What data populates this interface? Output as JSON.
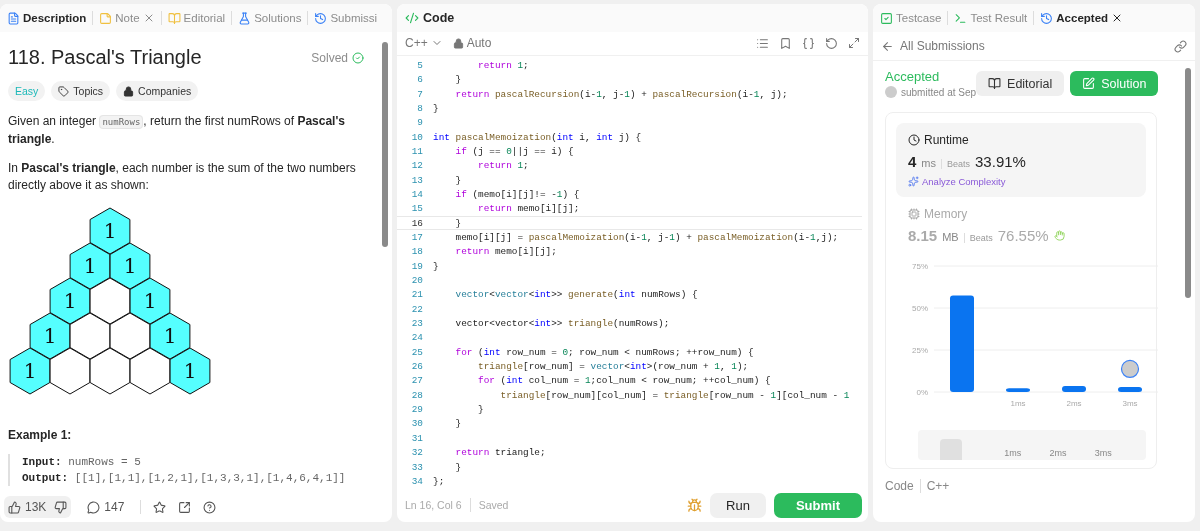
{
  "left_panel": {
    "tabs": [
      {
        "label": "Description",
        "kind": "description",
        "selected": true,
        "closable": false
      },
      {
        "label": "Note",
        "kind": "note",
        "selected": false,
        "closable": true
      },
      {
        "label": "Editorial",
        "kind": "editorial",
        "selected": false,
        "closable": false
      },
      {
        "label": "Solutions",
        "kind": "solutions",
        "selected": false,
        "closable": false
      },
      {
        "label": "Submissi",
        "kind": "submissions",
        "selected": false,
        "closable": false
      }
    ],
    "title": "118. Pascal's Triangle",
    "status": "Solved",
    "badges": [
      {
        "kind": "difficulty",
        "label": "Easy"
      },
      {
        "kind": "topics",
        "label": "Topics"
      },
      {
        "kind": "companies",
        "label": "Companies"
      }
    ],
    "paragraph_1": {
      "before": "Given an integer ",
      "code": "numRows",
      "after": ", return the first numRows of **Pascal's triangle**."
    },
    "paragraph_2": "In **Pascal's triangle**, each number is the sum of the two numbers directly above it as shown:",
    "triangle_rows": [
      [
        {
          "value": "1",
          "filled": true
        }
      ],
      [
        {
          "value": "1",
          "filled": true
        },
        {
          "value": "1",
          "filled": true
        }
      ],
      [
        {
          "value": "1",
          "filled": true
        },
        {
          "filled": false
        },
        {
          "value": "1",
          "filled": true
        }
      ],
      [
        {
          "value": "1",
          "filled": true
        },
        {
          "filled": false
        },
        {
          "filled": false
        },
        {
          "value": "1",
          "filled": true
        }
      ],
      [
        {
          "value": "1",
          "filled": true
        },
        {
          "filled": false
        },
        {
          "filled": false
        },
        {
          "filled": false
        },
        {
          "value": "1",
          "filled": true
        }
      ]
    ],
    "example_title": "Example 1:",
    "example_lines": [
      {
        "label": "Input:",
        "value": "numRows = 5"
      },
      {
        "label": "Output:",
        "value": "[[1],[1,1],[1,2,1],[1,3,3,1],[1,4,6,4,1]]"
      }
    ],
    "footer": {
      "likes": "13K",
      "comments": "147"
    }
  },
  "code_panel": {
    "title": "Code",
    "language": "C++",
    "mode": "Auto",
    "lines": [
      {
        "n": "5",
        "current": false,
        "parts": [
          {
            "kind": "kw",
            "text": "        return"
          },
          {
            "kind": "nu",
            "text": " 1"
          },
          {
            "kind": "p",
            "text": ";"
          }
        ]
      },
      {
        "n": "6",
        "current": false,
        "parts": [
          {
            "kind": "p",
            "text": "    }"
          }
        ]
      },
      {
        "n": "7",
        "current": false,
        "parts": [
          {
            "kind": "kw",
            "text": "    return"
          },
          {
            "kind": "fn",
            "text": " pascalRecursion"
          },
          {
            "kind": "p",
            "text": "(i-"
          },
          {
            "kind": "nu",
            "text": "1"
          },
          {
            "kind": "p",
            "text": ", j-"
          },
          {
            "kind": "nu",
            "text": "1"
          },
          {
            "kind": "p",
            "text": ") + "
          },
          {
            "kind": "fn",
            "text": "pascalRecursion"
          },
          {
            "kind": "p",
            "text": "(i-"
          },
          {
            "kind": "nu",
            "text": "1"
          },
          {
            "kind": "p",
            "text": ", j);"
          }
        ]
      },
      {
        "n": "8",
        "current": false,
        "parts": [
          {
            "kind": "p",
            "text": "}"
          }
        ]
      },
      {
        "n": "9",
        "current": false
      },
      {
        "n": "10",
        "current": false,
        "parts": [
          {
            "kind": "ty",
            "text": "int"
          },
          {
            "kind": "fn",
            "text": " pascalMemoization"
          },
          {
            "kind": "p",
            "text": "("
          },
          {
            "kind": "ty",
            "text": "int"
          },
          {
            "kind": "p",
            "text": " i, "
          },
          {
            "kind": "ty",
            "text": "int"
          },
          {
            "kind": "p",
            "text": " j) {"
          }
        ]
      },
      {
        "n": "11",
        "current": false,
        "parts": [
          {
            "kind": "kw",
            "text": "    if"
          },
          {
            "kind": "p",
            "text": " (j == "
          },
          {
            "kind": "nu",
            "text": "0"
          },
          {
            "kind": "p",
            "text": "||j == i) {"
          }
        ]
      },
      {
        "n": "12",
        "current": false,
        "parts": [
          {
            "kind": "kw",
            "text": "        return"
          },
          {
            "kind": "nu",
            "text": " 1"
          },
          {
            "kind": "p",
            "text": ";"
          }
        ]
      },
      {
        "n": "13",
        "current": false,
        "parts": [
          {
            "kind": "p",
            "text": "    }"
          }
        ]
      },
      {
        "n": "14",
        "current": false,
        "parts": [
          {
            "kind": "kw",
            "text": "    if"
          },
          {
            "kind": "p",
            "text": " (memo[i][j]!= -"
          },
          {
            "kind": "nu",
            "text": "1"
          },
          {
            "kind": "p",
            "text": ") {"
          }
        ]
      },
      {
        "n": "15",
        "current": false,
        "parts": [
          {
            "kind": "kw",
            "text": "        return"
          },
          {
            "kind": "p",
            "text": " memo[i][j];"
          }
        ]
      },
      {
        "n": "16",
        "current": true,
        "parts": [
          {
            "kind": "p",
            "text": "    }"
          }
        ]
      },
      {
        "n": "17",
        "current": false,
        "parts": [
          {
            "kind": "p",
            "text": "    memo[i][j] = "
          },
          {
            "kind": "fn",
            "text": "pascalMemoization"
          },
          {
            "kind": "p",
            "text": "(i-"
          },
          {
            "kind": "nu",
            "text": "1"
          },
          {
            "kind": "p",
            "text": ", j-"
          },
          {
            "kind": "nu",
            "text": "1"
          },
          {
            "kind": "p",
            "text": ") + "
          },
          {
            "kind": "fn",
            "text": "pascalMemoization"
          },
          {
            "kind": "p",
            "text": "(i-"
          },
          {
            "kind": "nu",
            "text": "1"
          },
          {
            "kind": "p",
            "text": ",j);"
          }
        ]
      },
      {
        "n": "18",
        "current": false,
        "parts": [
          {
            "kind": "kw",
            "text": "    return"
          },
          {
            "kind": "p",
            "text": " memo[i][j];"
          }
        ]
      },
      {
        "n": "19",
        "current": false,
        "parts": [
          {
            "kind": "p",
            "text": "}"
          }
        ]
      },
      {
        "n": "20",
        "current": false
      },
      {
        "n": "21",
        "current": false,
        "parts": [
          {
            "kind": "cl",
            "text": "    vector"
          },
          {
            "kind": "p",
            "text": "<"
          },
          {
            "kind": "cl",
            "text": "vector"
          },
          {
            "kind": "p",
            "text": "<"
          },
          {
            "kind": "ty",
            "text": "int"
          },
          {
            "kind": "p",
            "text": ">> "
          },
          {
            "kind": "fn",
            "text": "generate"
          },
          {
            "kind": "p",
            "text": "("
          },
          {
            "kind": "ty",
            "text": "int"
          },
          {
            "kind": "p",
            "text": " numRows) {"
          }
        ]
      },
      {
        "n": "22",
        "current": false
      },
      {
        "n": "23",
        "current": false,
        "parts": [
          {
            "kind": "p",
            "text": "    vector<vector<"
          },
          {
            "kind": "ty",
            "text": "int"
          },
          {
            "kind": "p",
            "text": ">> "
          },
          {
            "kind": "fn",
            "text": "triangle"
          },
          {
            "kind": "p",
            "text": "(numRows);"
          }
        ]
      },
      {
        "n": "24",
        "current": false
      },
      {
        "n": "25",
        "current": false,
        "parts": [
          {
            "kind": "kw",
            "text": "    for"
          },
          {
            "kind": "p",
            "text": " ("
          },
          {
            "kind": "ty",
            "text": "int"
          },
          {
            "kind": "p",
            "text": " row_num = "
          },
          {
            "kind": "nu",
            "text": "0"
          },
          {
            "kind": "p",
            "text": "; row_num < numRows; ++row_num) {"
          }
        ]
      },
      {
        "n": "26",
        "current": false,
        "parts": [
          {
            "kind": "fn",
            "text": "        triangle"
          },
          {
            "kind": "p",
            "text": "[row_num] = "
          },
          {
            "kind": "cl",
            "text": "vector"
          },
          {
            "kind": "p",
            "text": "<"
          },
          {
            "kind": "ty",
            "text": "int"
          },
          {
            "kind": "p",
            "text": ">(row_num + "
          },
          {
            "kind": "nu",
            "text": "1"
          },
          {
            "kind": "p",
            "text": ", "
          },
          {
            "kind": "nu",
            "text": "1"
          },
          {
            "kind": "p",
            "text": ");"
          }
        ]
      },
      {
        "n": "27",
        "current": false,
        "parts": [
          {
            "kind": "kw",
            "text": "        for"
          },
          {
            "kind": "p",
            "text": " ("
          },
          {
            "kind": "ty",
            "text": "int"
          },
          {
            "kind": "p",
            "text": " col_num = "
          },
          {
            "kind": "nu",
            "text": "1"
          },
          {
            "kind": "p",
            "text": ";col_num < row_num; ++col_num) {"
          }
        ]
      },
      {
        "n": "28",
        "current": false,
        "parts": [
          {
            "kind": "fn",
            "text": "            triangle"
          },
          {
            "kind": "p",
            "text": "[row_num][col_num] = "
          },
          {
            "kind": "fn",
            "text": "triangle"
          },
          {
            "kind": "p",
            "text": "[row_num - "
          },
          {
            "kind": "nu",
            "text": "1"
          },
          {
            "kind": "p",
            "text": "][col_num - "
          },
          {
            "kind": "nu",
            "text": "1"
          }
        ]
      },
      {
        "n": "29",
        "current": false,
        "parts": [
          {
            "kind": "p",
            "text": "        }"
          }
        ]
      },
      {
        "n": "30",
        "current": false,
        "parts": [
          {
            "kind": "p",
            "text": "    }"
          }
        ]
      },
      {
        "n": "31",
        "current": false
      },
      {
        "n": "32",
        "current": false,
        "parts": [
          {
            "kind": "kw",
            "text": "    return"
          },
          {
            "kind": "p",
            "text": " triangle;"
          }
        ]
      },
      {
        "n": "33",
        "current": false,
        "parts": [
          {
            "kind": "p",
            "text": "    }"
          }
        ]
      },
      {
        "n": "34",
        "current": false,
        "parts": [
          {
            "kind": "p",
            "text": "};"
          }
        ]
      }
    ],
    "cursor": "Ln 16, Col 6",
    "save_status": "Saved",
    "buttons": [
      {
        "kind": "run",
        "label": "Run"
      },
      {
        "kind": "submit",
        "label": "Submit"
      }
    ]
  },
  "result_panel": {
    "tabs": [
      {
        "label": "Testcase",
        "kind": "testcase",
        "selected": false,
        "closable": false
      },
      {
        "label": "Test Result",
        "kind": "result",
        "selected": false,
        "closable": false
      },
      {
        "label": "Accepted",
        "kind": "accepted",
        "selected": true,
        "closable": true
      }
    ],
    "back_link": "All Submissions",
    "status": "Accepted",
    "submitted": "submitted at Sep",
    "buttons": [
      {
        "kind": "editorial",
        "label": "Editorial"
      },
      {
        "kind": "solution",
        "label": "Solution"
      }
    ],
    "runtime": {
      "title": "Runtime",
      "value": "4",
      "unit": "ms",
      "beats_label": "Beats",
      "beats": "33.91%",
      "analyze": "Analyze Complexity"
    },
    "memory": {
      "title": "Memory",
      "value": "8.15",
      "unit": "MB",
      "beats_label": "Beats",
      "beats": "76.55%"
    },
    "chart_data": {
      "type": "bar",
      "categories": [
        null,
        "1ms",
        "2ms",
        "3ms"
      ],
      "series": [
        {
          "color": "#0a74f0",
          "values": [
            57.5,
            2.3,
            3.5,
            3
          ]
        }
      ],
      "ylim": [
        0,
        75
      ],
      "yticks": [
        {
          "value": 0,
          "label": "0%"
        },
        {
          "value": 25,
          "label": "25%"
        },
        {
          "value": 50,
          "label": "50%"
        },
        {
          "value": 75,
          "label": "75%"
        }
      ]
    },
    "range_labels": [
      "1ms",
      "2ms",
      "3ms"
    ],
    "code_footer": {
      "label": "Code",
      "language": "C++"
    }
  }
}
